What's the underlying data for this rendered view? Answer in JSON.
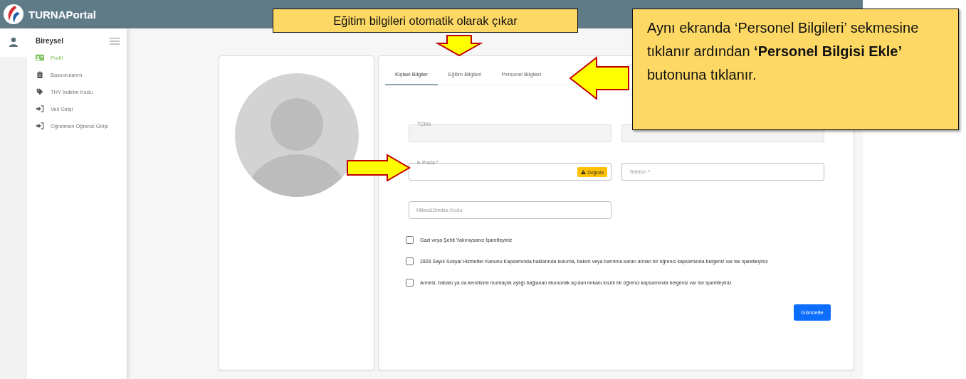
{
  "header": {
    "title": "TURNAPortal"
  },
  "sidebar": {
    "title": "Bireysel",
    "items": [
      {
        "label": "Profil",
        "selected": true
      },
      {
        "label": "Basvurularım",
        "selected": false
      },
      {
        "label": "THY İndirim Kodu",
        "selected": false
      },
      {
        "label": "Veli Girişi",
        "selected": false
      },
      {
        "label": "Öğretmen Öğrenci Girişi",
        "selected": false
      }
    ]
  },
  "tabs": [
    {
      "label": "Kişisel Bilgiler",
      "selected": true
    },
    {
      "label": "Eğitim Bilgileri",
      "selected": false
    },
    {
      "label": "Personel Bilgileri",
      "selected": false
    }
  ],
  "fields": [
    {
      "kind": "floating",
      "label": "TCKN",
      "disabled": true
    },
    {
      "kind": "floating",
      "disabled": true
    },
    {
      "kind": "floating",
      "label": "E-Posta *",
      "disabled": false,
      "button": "Doğrula"
    },
    {
      "kind": "placeholder",
      "placeholder": "Telefon *"
    },
    {
      "kind": "placeholder",
      "placeholder": "Miles&Smiles Kodu"
    }
  ],
  "checkboxes": [
    {
      "label": "Gazi veya Şehit Yakınıysanız İşaretleyiniz",
      "checked": false
    },
    {
      "label": "2828 Sayılı Sosyal Hizmetler Kanunu Kapsamında haklarında koruma, bakım veya barınma kararı alınan bir öğrenci kapsamında belgeniz var ise işaretleyiniz",
      "checked": false
    },
    {
      "label": "Annesi, babası ya da kendisine muhtaçlık aylığı bağlanan ekonomik açıdan imkanı kısıtlı bir öğrenci kapsamında belgeniz var ise işaretleyiniz",
      "checked": false
    }
  ],
  "submit_button": "Güncelle",
  "callouts": [
    {
      "kind": "top",
      "text": "Eğitim bilgileri otomatik olarak çıkar"
    },
    {
      "kind": "side",
      "text": "Aynı ekranda ‘Personel Bilgileri’ sekmesine tıklanır ardından **‘Personel Bilgisi Ekle’** butonuna tıklanır."
    }
  ],
  "arrows": [
    {
      "kind": "down"
    },
    {
      "kind": "left"
    },
    {
      "kind": "right"
    }
  ]
}
